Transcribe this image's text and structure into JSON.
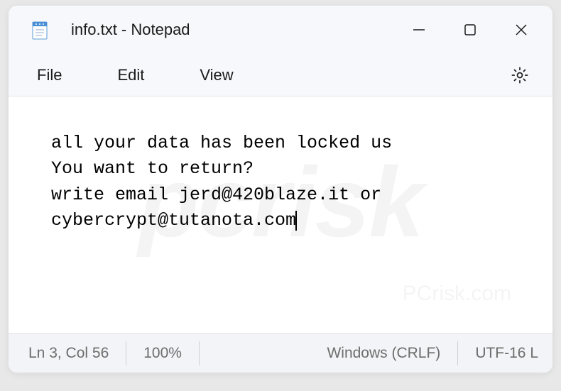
{
  "titlebar": {
    "title": "info.txt - Notepad"
  },
  "menu": {
    "file": "File",
    "edit": "Edit",
    "view": "View"
  },
  "content": {
    "line1": "all your data has been locked us",
    "line2": "You want to return?",
    "line3": "write email jerd@420blaze.it or",
    "line4": "cybercrypt@tutanota.com"
  },
  "statusbar": {
    "cursor": "Ln 3, Col 56",
    "zoom": "100%",
    "lineending": "Windows (CRLF)",
    "encoding": "UTF-16 L"
  },
  "watermark": {
    "main": "pcrisk",
    "sub": "PCrisk.com"
  }
}
